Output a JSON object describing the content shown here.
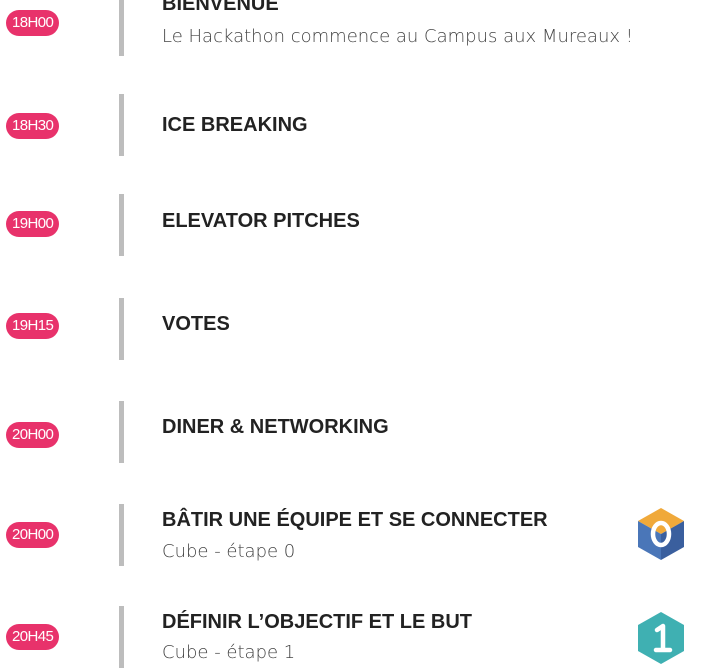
{
  "schedule": [
    {
      "time": "18H00",
      "title": "BIENVENUE",
      "subtitle": "Le Hackathon commence au Campus aux Mureaux !"
    },
    {
      "time": "18H30",
      "title": "ICE BREAKING"
    },
    {
      "time": "19H00",
      "title": "ELEVATOR PITCHES"
    },
    {
      "time": "19H15",
      "title": "VOTES"
    },
    {
      "time": "20H00",
      "title": "DINER & NETWORKING"
    },
    {
      "time": "20H00",
      "title": "BÂTIR UNE ÉQUIPE ET SE CONNECTER",
      "subtitle": "Cube - étape 0",
      "cube": {
        "number": "0",
        "icon": "orange-blue-cube-icon"
      }
    },
    {
      "time": "20H45",
      "title": "DÉFINIR L’OBJECTIF ET LE BUT",
      "subtitle": "Cube - étape 1",
      "cube": {
        "number": "1",
        "icon": "teal-cube-icon"
      }
    }
  ],
  "colors": {
    "badge": "#e8326b",
    "bar": "#bdbdbd",
    "cube0_top": "#f0a93a",
    "cube0_left": "#4a76b8",
    "cube0_right": "#3a5f9e",
    "cube1_top": "#3fb0b2",
    "cube1_left": "#2e9fa1",
    "cube1_right": "#2b8f91"
  }
}
